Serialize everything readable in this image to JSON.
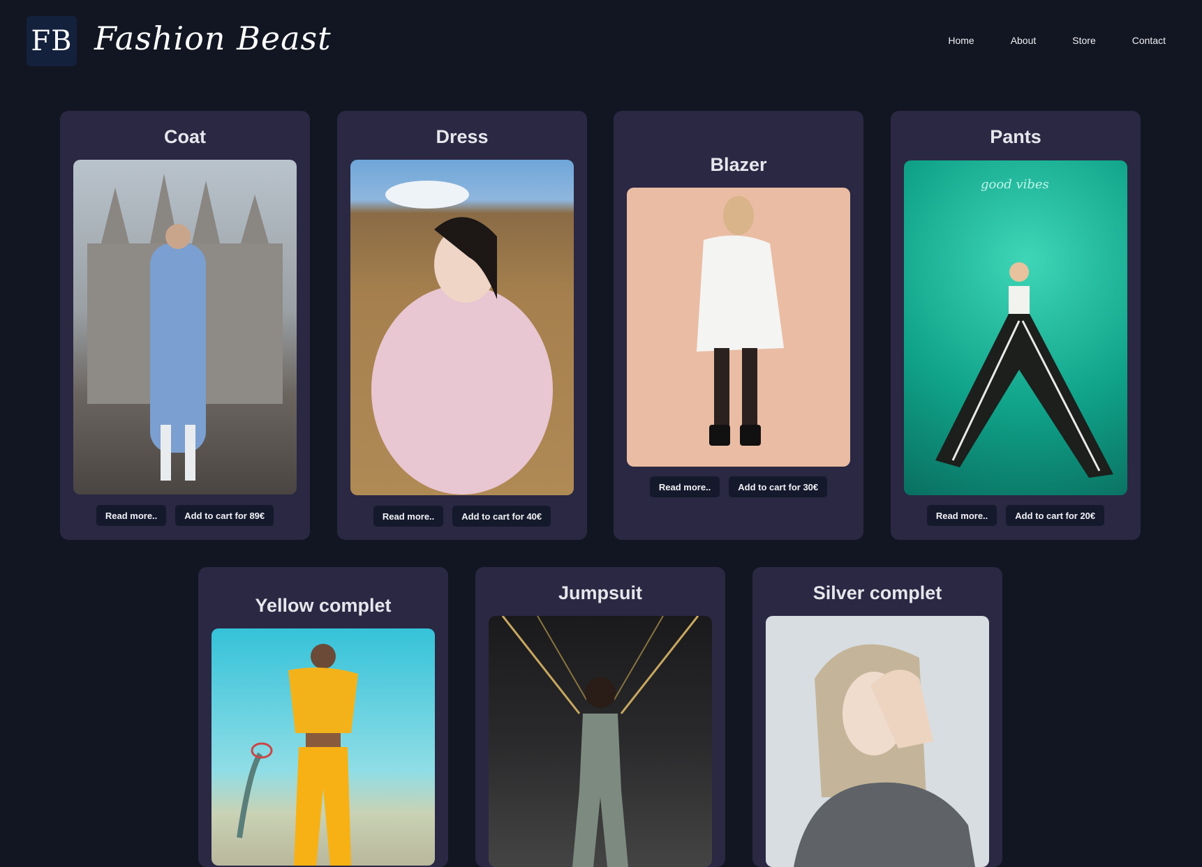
{
  "header": {
    "logo_text": "FB",
    "brand_name": "Fashion Beast",
    "nav": [
      "Home",
      "About",
      "Store",
      "Contact"
    ]
  },
  "products": [
    {
      "title": "Coat",
      "read_more": "Read more..",
      "add_to_cart": "Add to cart for 89€"
    },
    {
      "title": "Dress",
      "read_more": "Read more..",
      "add_to_cart": "Add to cart for 40€"
    },
    {
      "title": "Blazer",
      "read_more": "Read more..",
      "add_to_cart": "Add to cart for 30€"
    },
    {
      "title": "Pants",
      "read_more": "Read more..",
      "add_to_cart": "Add to cart for 20€"
    },
    {
      "title": "Yellow complet"
    },
    {
      "title": "Jumpsuit"
    },
    {
      "title": "Silver complet"
    }
  ],
  "colors": {
    "page_background": "#121622",
    "card_background": "#2a2843",
    "button_background": "#141a2c",
    "logo_background": "#14213d"
  }
}
